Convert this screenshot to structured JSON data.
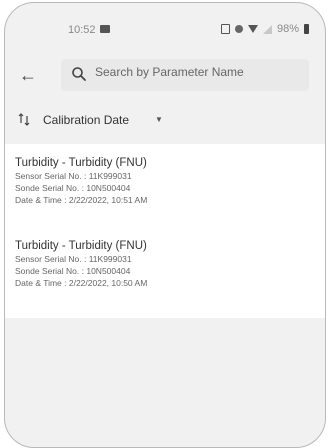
{
  "status_bar": {
    "time": "10:52",
    "battery": "98%"
  },
  "search": {
    "placeholder": "Search by Parameter Name",
    "value": ""
  },
  "sort": {
    "label": "Calibration Date"
  },
  "records": [
    {
      "title": "Turbidity - Turbidity (FNU)",
      "sensor": "Sensor Serial No. : 11K999031",
      "sonde": "Sonde Serial No. : 10N500404",
      "datetime": "Date & Time : 2/22/2022, 10:51 AM"
    },
    {
      "title": "Turbidity - Turbidity (FNU)",
      "sensor": "Sensor Serial No. : 11K999031",
      "sonde": "Sonde Serial No. : 10N500404",
      "datetime": "Date & Time : 2/22/2022, 10:50 AM"
    }
  ]
}
